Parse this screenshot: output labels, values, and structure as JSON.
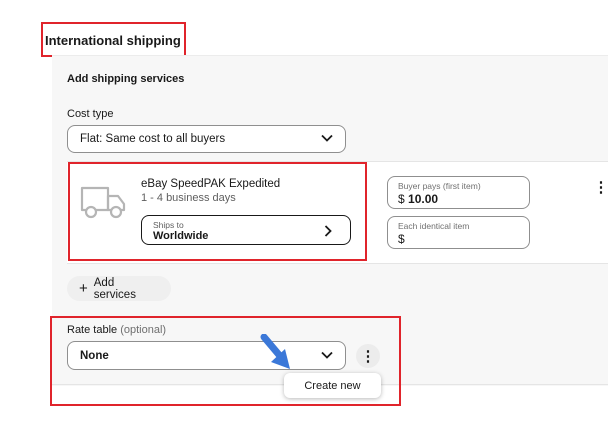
{
  "section": {
    "title": "International shipping"
  },
  "services": {
    "heading": "Add shipping services",
    "cost_type_label": "Cost type",
    "cost_type_value": "Flat: Same cost to all buyers",
    "service": {
      "name": "eBay SpeedPAK Expedited",
      "days": "1 - 4 business days",
      "ships_to_label": "Ships to",
      "ships_to_value": "Worldwide",
      "icon": "truck-icon"
    },
    "buyer_pays_label": "Buyer pays (first item)",
    "buyer_pays_currency": "$",
    "buyer_pays_value": "10.00",
    "each_identical_label": "Each identical item",
    "each_identical_currency": "$",
    "add_services_label": "Add services"
  },
  "rate_table": {
    "label": "Rate table",
    "optional": "(optional)",
    "value": "None",
    "menu_item": "Create new"
  },
  "colors": {
    "highlight": "#e0242b",
    "pointer_arrow": "#3b78d8"
  }
}
